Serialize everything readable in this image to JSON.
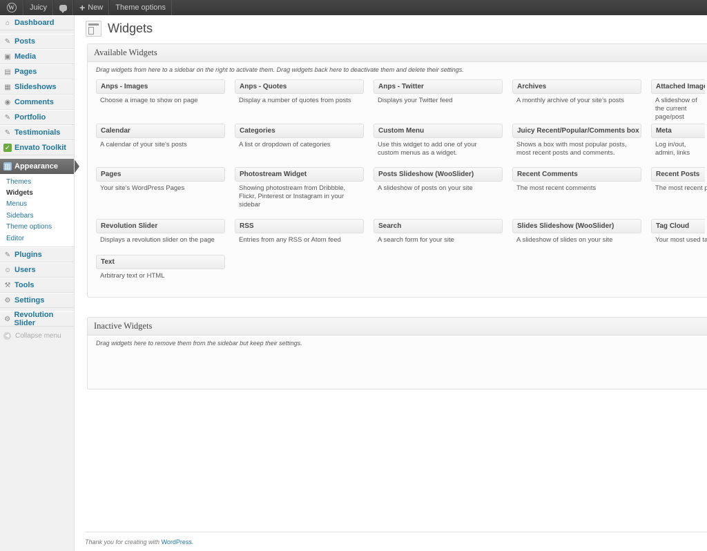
{
  "adminbar": {
    "site_name": "Juicy",
    "new_label": "New",
    "theme_options_label": "Theme options"
  },
  "menu": {
    "dashboard": "Dashboard",
    "posts": "Posts",
    "media": "Media",
    "pages": "Pages",
    "slideshows": "Slideshows",
    "comments": "Comments",
    "portfolio": "Portfolio",
    "testimonials": "Testimonials",
    "envato": "Envato Toolkit",
    "appearance": "Appearance",
    "appearance_submenu": [
      "Themes",
      "Widgets",
      "Menus",
      "Sidebars",
      "Theme options",
      "Editor"
    ],
    "plugins": "Plugins",
    "users": "Users",
    "tools": "Tools",
    "settings": "Settings",
    "revolution": "Revolution Slider",
    "collapse": "Collapse menu"
  },
  "page": {
    "title": "Widgets"
  },
  "available": {
    "title": "Available Widgets",
    "description": "Drag widgets from here to a sidebar on the right to activate them. Drag widgets back here to deactivate them and delete their settings."
  },
  "widgets": [
    {
      "title": "Anps - Images",
      "desc": "Choose a image to show on page"
    },
    {
      "title": "Anps - Quotes",
      "desc": "Display a number of quotes from posts"
    },
    {
      "title": "Anps - Twitter",
      "desc": "Displays your Twitter feed"
    },
    {
      "title": "Archives",
      "desc": "A monthly archive of your site's posts"
    },
    {
      "title": "Attached Images",
      "desc": "A slideshow of the current page/post"
    },
    {
      "title": "Calendar",
      "desc": "A calendar of your site's posts"
    },
    {
      "title": "Categories",
      "desc": "A list or dropdown of categories"
    },
    {
      "title": "Custom Menu",
      "desc": "Use this widget to add one of your custom menus as a widget."
    },
    {
      "title": "Juicy Recent/Popular/Comments box",
      "desc": "Shows a box with most popular posts, most recent posts and comments."
    },
    {
      "title": "Meta",
      "desc": "Log in/out, admin, links"
    },
    {
      "title": "Pages",
      "desc": "Your site's WordPress Pages"
    },
    {
      "title": "Photostream Widget",
      "desc": "Showing photostream from Dribbble, Flickr, Pinterest or Instagram in your sidebar"
    },
    {
      "title": "Posts Slideshow (WooSlider)",
      "desc": "A slideshow of posts on your site"
    },
    {
      "title": "Recent Comments",
      "desc": "The most recent comments"
    },
    {
      "title": "Recent Posts",
      "desc": "The most recent p"
    },
    {
      "title": "Revolution Slider",
      "desc": "Displays a revolution slider on the page"
    },
    {
      "title": "RSS",
      "desc": "Entries from any RSS or Atom feed"
    },
    {
      "title": "Search",
      "desc": "A search form for your site"
    },
    {
      "title": "Slides Slideshow (WooSlider)",
      "desc": "A slideshow of slides on your site"
    },
    {
      "title": "Tag Cloud",
      "desc": "Your most used ta"
    },
    {
      "title": "Text",
      "desc": "Arbitrary text or HTML"
    }
  ],
  "inactive": {
    "title": "Inactive Widgets",
    "description": "Drag widgets here to remove them from the sidebar but keep their settings."
  },
  "footer": {
    "text": "Thank you for creating with",
    "link": "WordPress",
    "suffix": "."
  },
  "colors": {
    "link": "#21759b",
    "adminbar": "#464646",
    "current_menu": "#6d6d6d"
  }
}
